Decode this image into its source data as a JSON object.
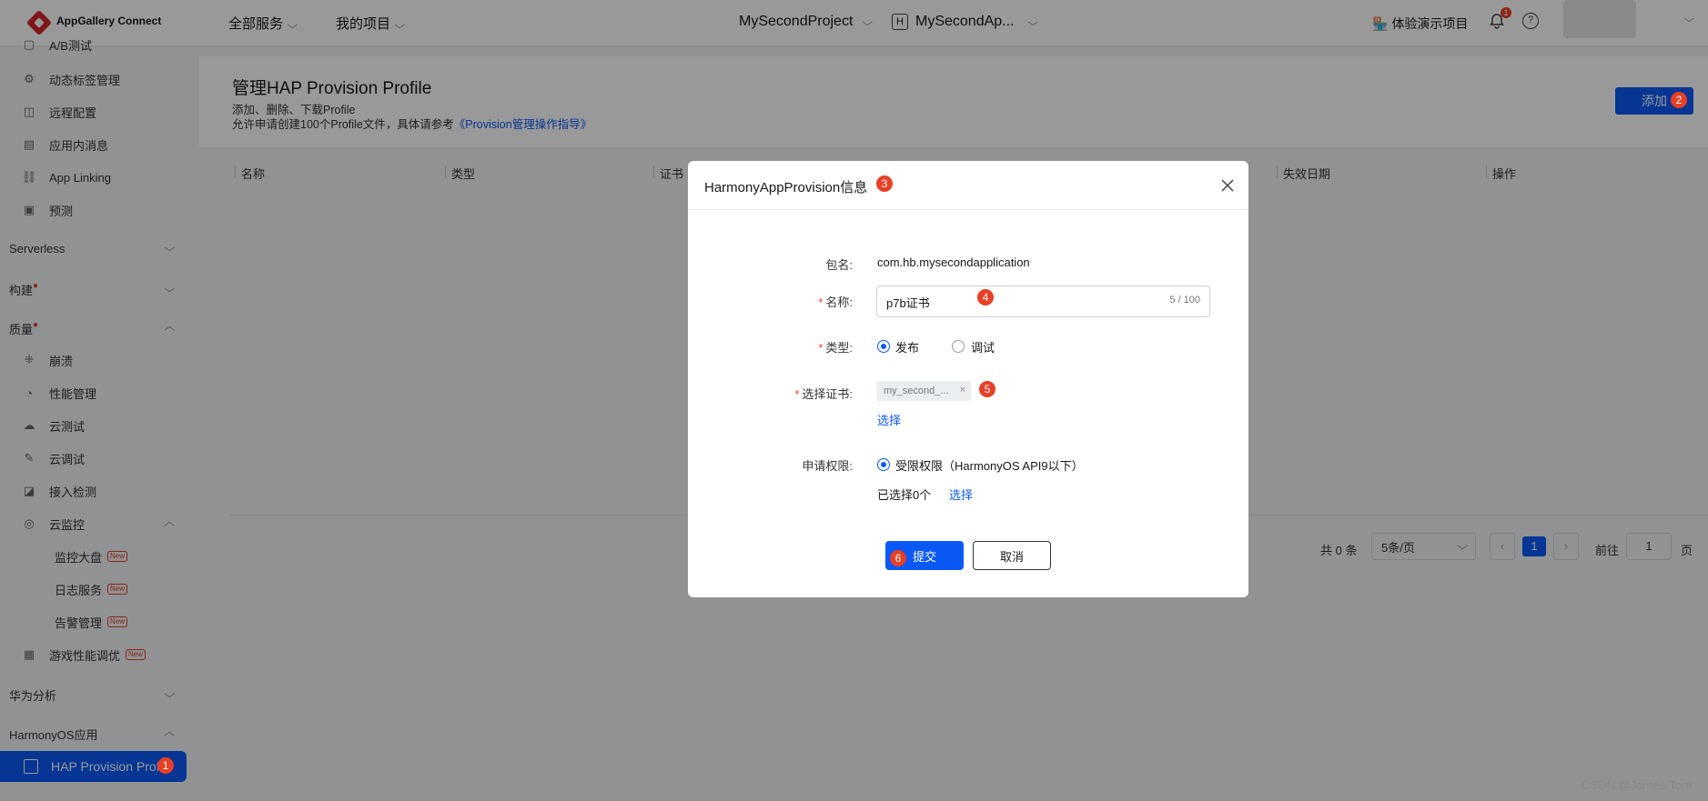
{
  "topbar": {
    "brand": "AppGallery Connect",
    "all_services": "全部服务",
    "my_projects": "我的项目",
    "project_name": "MySecondProject",
    "app_badge_letter": "H",
    "app_name": "MySecondAp...",
    "demo_project": "体验演示项目",
    "notification_count": "1",
    "help_glyph": "?"
  },
  "sidebar": {
    "partial_top": "A/B测试",
    "items_top": [
      {
        "label": "动态标签管理",
        "icon": "tag-icon"
      },
      {
        "label": "远程配置",
        "icon": "remote-config-icon"
      },
      {
        "label": "应用内消息",
        "icon": "message-icon"
      },
      {
        "label": "App Linking",
        "icon": "link-icon"
      },
      {
        "label": "预测",
        "icon": "predict-icon"
      }
    ],
    "groups": {
      "serverless": "Serverless",
      "build": "构建",
      "quality": "质量",
      "analytics": "华为分析",
      "harmonyos": "HarmonyOS应用"
    },
    "quality_items": [
      {
        "label": "崩溃",
        "icon": "crash-icon"
      },
      {
        "label": "性能管理",
        "icon": "performance-icon"
      },
      {
        "label": "云测试",
        "icon": "cloud-test-icon"
      },
      {
        "label": "云调试",
        "icon": "cloud-debug-icon"
      },
      {
        "label": "接入检测",
        "icon": "access-check-icon"
      },
      {
        "label": "云监控",
        "icon": "cloud-monitor-icon"
      }
    ],
    "monitor_sub": [
      {
        "label": "监控大盘",
        "tag": "New"
      },
      {
        "label": "日志服务",
        "tag": "New"
      },
      {
        "label": "告警管理",
        "tag": "New"
      }
    ],
    "game_perf": {
      "label": "游戏性能调优",
      "tag": "New"
    },
    "active_item": "HAP Provision Profil"
  },
  "main": {
    "title": "管理HAP Provision Profile",
    "sub1": "添加、删除、下载Profile",
    "sub2": "允许申请创建100个Profile文件，具体请参考",
    "guide_link": "《Provision管理操作指导》",
    "add_button": "添加",
    "columns": [
      "名称",
      "类型",
      "证书",
      "失效日期",
      "操作"
    ],
    "pager": {
      "total": "共 0 条",
      "page_size": "5条/页",
      "current_page": "1",
      "goto_label": "前往",
      "goto_value": "1",
      "page_unit": "页"
    }
  },
  "dialog": {
    "title": "HarmonyAppProvision信息",
    "package_label": "包名:",
    "package_value": "com.hb.mysecondapplication",
    "name_label": "名称:",
    "name_value": "p7b证书",
    "name_count": "5 / 100",
    "type_label": "类型:",
    "type_release": "发布",
    "type_debug": "调试",
    "cert_label": "选择证书:",
    "cert_tag": "my_second_...",
    "cert_select": "选择",
    "perm_label": "申请权限:",
    "perm_option": "受限权限（HarmonyOS API9以下）",
    "perm_selected": "已选择0个",
    "perm_select": "选择",
    "submit": "提交",
    "cancel": "取消"
  },
  "steps": [
    "1",
    "2",
    "3",
    "4",
    "5",
    "6"
  ],
  "watermark": "CSDN @James-Tom",
  "colors": {
    "primary": "#0a59f7",
    "badge": "#e84026"
  }
}
